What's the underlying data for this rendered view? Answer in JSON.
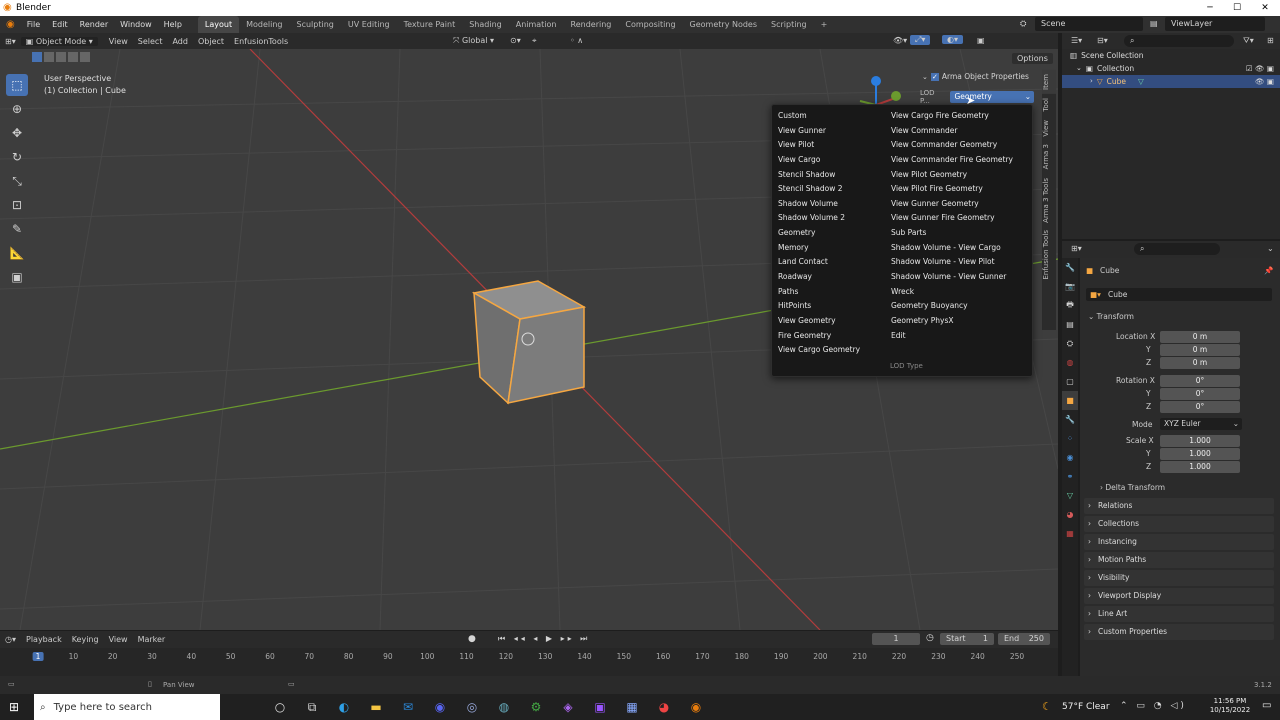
{
  "titlebar": {
    "title": "Blender",
    "minimize": "─",
    "maximize": "☐",
    "close": "✕"
  },
  "menu": [
    "File",
    "Edit",
    "Render",
    "Window",
    "Help"
  ],
  "workspaces": [
    "Layout",
    "Modeling",
    "Sculpting",
    "UV Editing",
    "Texture Paint",
    "Shading",
    "Animation",
    "Rendering",
    "Compositing",
    "Geometry Nodes",
    "Scripting",
    "+"
  ],
  "scene": {
    "scene_label": "Scene",
    "viewlayer_label": "ViewLayer"
  },
  "viewport_header": {
    "mode": "Object Mode",
    "menus": [
      "View",
      "Select",
      "Add",
      "Object",
      "EnfusionTools"
    ],
    "orientation": "Global",
    "options": "Options"
  },
  "viewport_info": {
    "line1": "User Perspective",
    "line2": "(1) Collection | Cube"
  },
  "npanel": {
    "tabs": [
      "Item",
      "Tool",
      "View",
      "Arma 3",
      "Arma 3 Tools",
      "Enfusion Tools"
    ],
    "section_title": "Arma Object Properties",
    "lod_label": "LOD P...",
    "lod_value": "Geometry"
  },
  "dropdown": {
    "col1": [
      "Custom",
      "View Gunner",
      "View Pilot",
      "View Cargo",
      "Stencil Shadow",
      "Stencil Shadow 2",
      "Shadow Volume",
      "Shadow Volume 2",
      "Geometry",
      "Memory",
      "Land Contact",
      "Roadway",
      "Paths",
      "HitPoints",
      "View Geometry",
      "Fire Geometry",
      "View Cargo Geometry"
    ],
    "col2": [
      "View Cargo Fire Geometry",
      "View Commander",
      "View Commander Geometry",
      "View Commander Fire Geometry",
      "View Pilot Geometry",
      "View Pilot Fire Geometry",
      "View Gunner Geometry",
      "View Gunner Fire Geometry",
      "Sub Parts",
      "Shadow Volume - View Cargo",
      "Shadow Volume - View Pilot",
      "Shadow Volume - View Gunner",
      "Wreck",
      "Geometry Buoyancy",
      "Geometry PhysX",
      "Edit"
    ],
    "footer": "LOD Type"
  },
  "timeline": {
    "menus": [
      "Playback",
      "Keying",
      "View",
      "Marker"
    ],
    "current_frame": "1",
    "start_label": "Start",
    "start": "1",
    "end_label": "End",
    "end": "250",
    "ticks": [
      "1",
      "10",
      "20",
      "30",
      "40",
      "50",
      "60",
      "70",
      "80",
      "90",
      "100",
      "110",
      "120",
      "130",
      "140",
      "150",
      "160",
      "170",
      "180",
      "190",
      "200",
      "210",
      "220",
      "230",
      "240",
      "250"
    ]
  },
  "status": {
    "left": "Pan View",
    "version": "3.1.2"
  },
  "outliner": {
    "rows": [
      {
        "label": "Scene Collection",
        "indent": 0
      },
      {
        "label": "Collection",
        "indent": 1
      },
      {
        "label": "Cube",
        "indent": 2
      }
    ]
  },
  "properties": {
    "object_name": "Cube",
    "datablock": "Cube",
    "transform_title": "Transform",
    "location_label": "Location X",
    "loc": [
      "0 m",
      "0 m",
      "0 m"
    ],
    "rotation_label": "Rotation X",
    "rot": [
      "0°",
      "0°",
      "0°"
    ],
    "mode_label": "Mode",
    "mode_value": "XYZ Euler",
    "scale_label": "Scale X",
    "scale": [
      "1.000",
      "1.000",
      "1.000"
    ],
    "axis_y": "Y",
    "axis_z": "Z",
    "delta": "Delta Transform",
    "panels": [
      "Relations",
      "Collections",
      "Instancing",
      "Motion Paths",
      "Visibility",
      "Viewport Display",
      "Line Art",
      "Custom Properties"
    ]
  },
  "taskbar": {
    "search_placeholder": "Type here to search",
    "weather": "57°F  Clear",
    "time": "11:56 PM",
    "date": "10/15/2022"
  },
  "colors": {
    "accent": "#4772b3",
    "selection_outline": "#f5a742",
    "x_axis": "#b33c3c",
    "y_axis": "#6b9a2e"
  }
}
